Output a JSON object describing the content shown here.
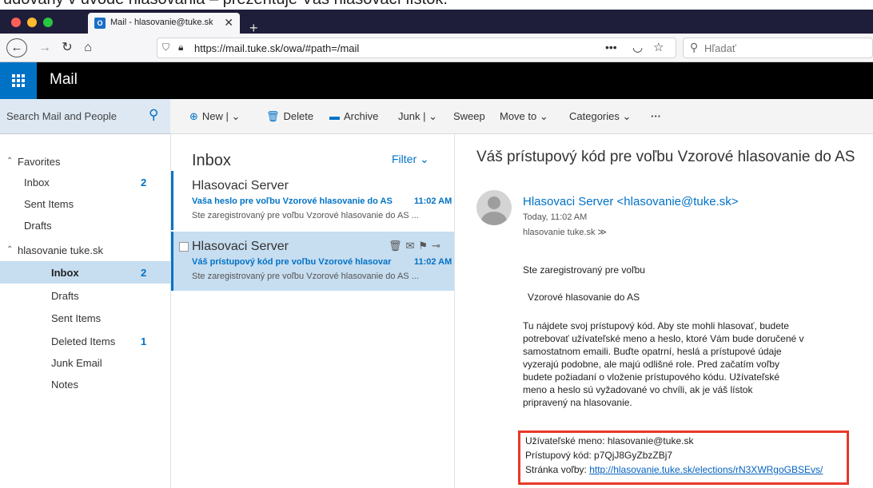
{
  "caption": "udovaný v úvode hlasovania – prezentuje Váš hlasovací lístok.",
  "browser": {
    "tab_title": "Mail - hlasovanie@tuke.sk",
    "tab_close": "✕",
    "new_tab": "+",
    "url": "https://mail.tuke.sk/owa/#path=/mail",
    "search_placeholder": "Hľadať"
  },
  "owa": {
    "app_name": "Mail",
    "search_placeholder": "Search Mail and People",
    "commands": {
      "new": "New",
      "delete": "Delete",
      "archive": "Archive",
      "junk": "Junk",
      "sweep": "Sweep",
      "move_to": "Move to",
      "categories": "Categories",
      "more": "···"
    },
    "folders": [
      {
        "label": "Favorites",
        "count": ""
      },
      {
        "label": "Inbox",
        "count": "2"
      },
      {
        "label": "Sent Items",
        "count": ""
      },
      {
        "label": "Drafts",
        "count": ""
      },
      {
        "label": "hlasovanie tuke.sk",
        "count": ""
      },
      {
        "label": "Inbox",
        "count": "2"
      },
      {
        "label": "Drafts",
        "count": ""
      },
      {
        "label": "Sent Items",
        "count": ""
      },
      {
        "label": "Deleted Items",
        "count": "1"
      },
      {
        "label": "Junk Email",
        "count": ""
      },
      {
        "label": "Notes",
        "count": ""
      }
    ],
    "list": {
      "title": "Inbox",
      "filter": "Filter",
      "messages": [
        {
          "sender": "Hlasovaci Server",
          "subject": "Vaša heslo pre voľbu Vzorové hlasovanie do AS",
          "time": "11:02 AM",
          "preview": "Ste zaregistrovaný pre voľbu  Vzorové hlasovanie do AS ..."
        },
        {
          "sender": "Hlasovaci Server",
          "subject": "Váš prístupový kód pre voľbu Vzorové hlasovar",
          "time": "11:02 AM",
          "preview": "Ste zaregistrovaný pre voľbu  Vzorové hlasovanie do AS ..."
        }
      ]
    },
    "reading": {
      "subject": "Váš prístupový kód pre voľbu Vzorové hlasovanie do AS",
      "from": "Hlasovaci Server <hlasovanie@tuke.sk>",
      "date": "Today, 11:02 AM",
      "to": "hlasovanie tuke.sk  ≫",
      "para1": "Ste zaregistrovaný pre voľbu",
      "para2": "Vzorové hlasovanie do AS",
      "para3_lines": [
        "Tu nájdete svoj prístupový kód. Aby ste mohli hlasovať, budete",
        "potrebovať užívateľské meno a heslo, ktoré Vám bude doručené v",
        "samostatnom emaili. Buďte opatrní, heslá a prístupové údaje",
        "vyzerajú podobne, ale majú odlišné role. Pred začatím voľby",
        "budete požiadaní o vloženie prístupového kódu. Užívateľské",
        "meno a heslo sú vyžadované vo chvíli, ak je váš lístok",
        "pripravený na hlasovanie."
      ],
      "username_line": "Užívateľské meno: hlasovanie@tuke.sk",
      "code_line": "Prístupový kód: p7QjJ8GyZbzZBj7",
      "page_label": "Stránka voľby: ",
      "page_link": "http://hlasovanie.tuke.sk/elections/rN3XWRgoGBSEvs/"
    }
  },
  "colors": {
    "accent": "#0072c6",
    "selected": "#c7ddf0",
    "highlight_box": "#e8382a"
  }
}
